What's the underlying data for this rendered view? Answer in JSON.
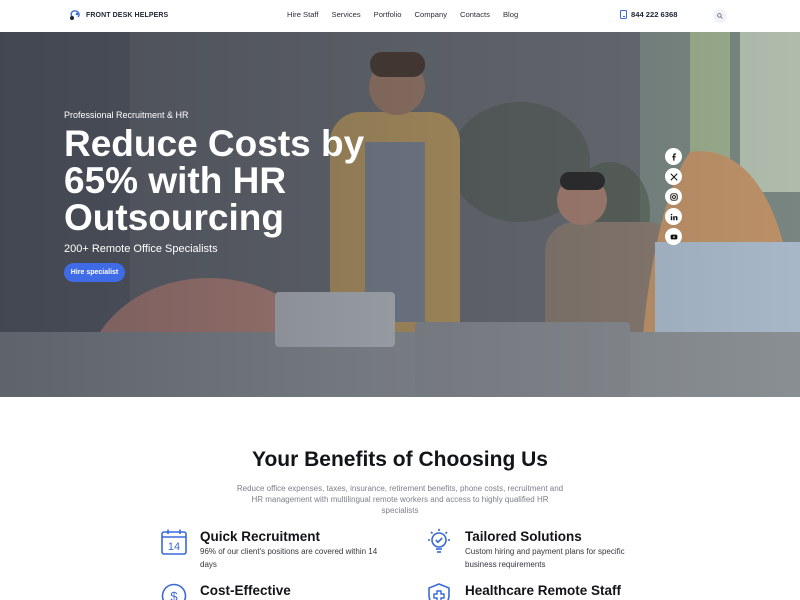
{
  "header": {
    "logo_text": "FRONT DESK HELPERS",
    "nav": [
      "Hire Staff",
      "Services",
      "Portfolio",
      "Company",
      "Contacts",
      "Blog"
    ],
    "phone": "844 222 6368",
    "search_icon": "search-icon",
    "accent_color": "#3f6ce6"
  },
  "hero": {
    "kicker": "Professional Recruitment & HR",
    "headline": "Reduce Costs by 65% with HR Outsourcing",
    "subhead": "200+ Remote Office Specialists",
    "cta_label": "Hire specialist",
    "socials": [
      "facebook-icon",
      "x-icon",
      "instagram-icon",
      "linkedin-icon",
      "youtube-icon"
    ]
  },
  "benefits": {
    "title": "Your Benefits of Choosing Us",
    "description": "Reduce office expenses, taxes, insurance, retirement benefits, phone costs, recruitment and HR management with multilingual remote workers and access to highly qualified HR specialists",
    "items": [
      {
        "title": "Quick Recruitment",
        "text": "96% of our client's positions are covered within 14 days",
        "icon": "calendar-icon",
        "icon_text": "14"
      },
      {
        "title": "Tailored Solutions",
        "text": "Custom hiring and payment plans for specific business requirements",
        "icon": "lightbulb-check-icon"
      },
      {
        "title": "Cost-Effective",
        "text": "",
        "icon": "dollar-coin-icon"
      },
      {
        "title": "Healthcare Remote Staff",
        "text": "",
        "icon": "medical-shield-icon"
      }
    ]
  }
}
